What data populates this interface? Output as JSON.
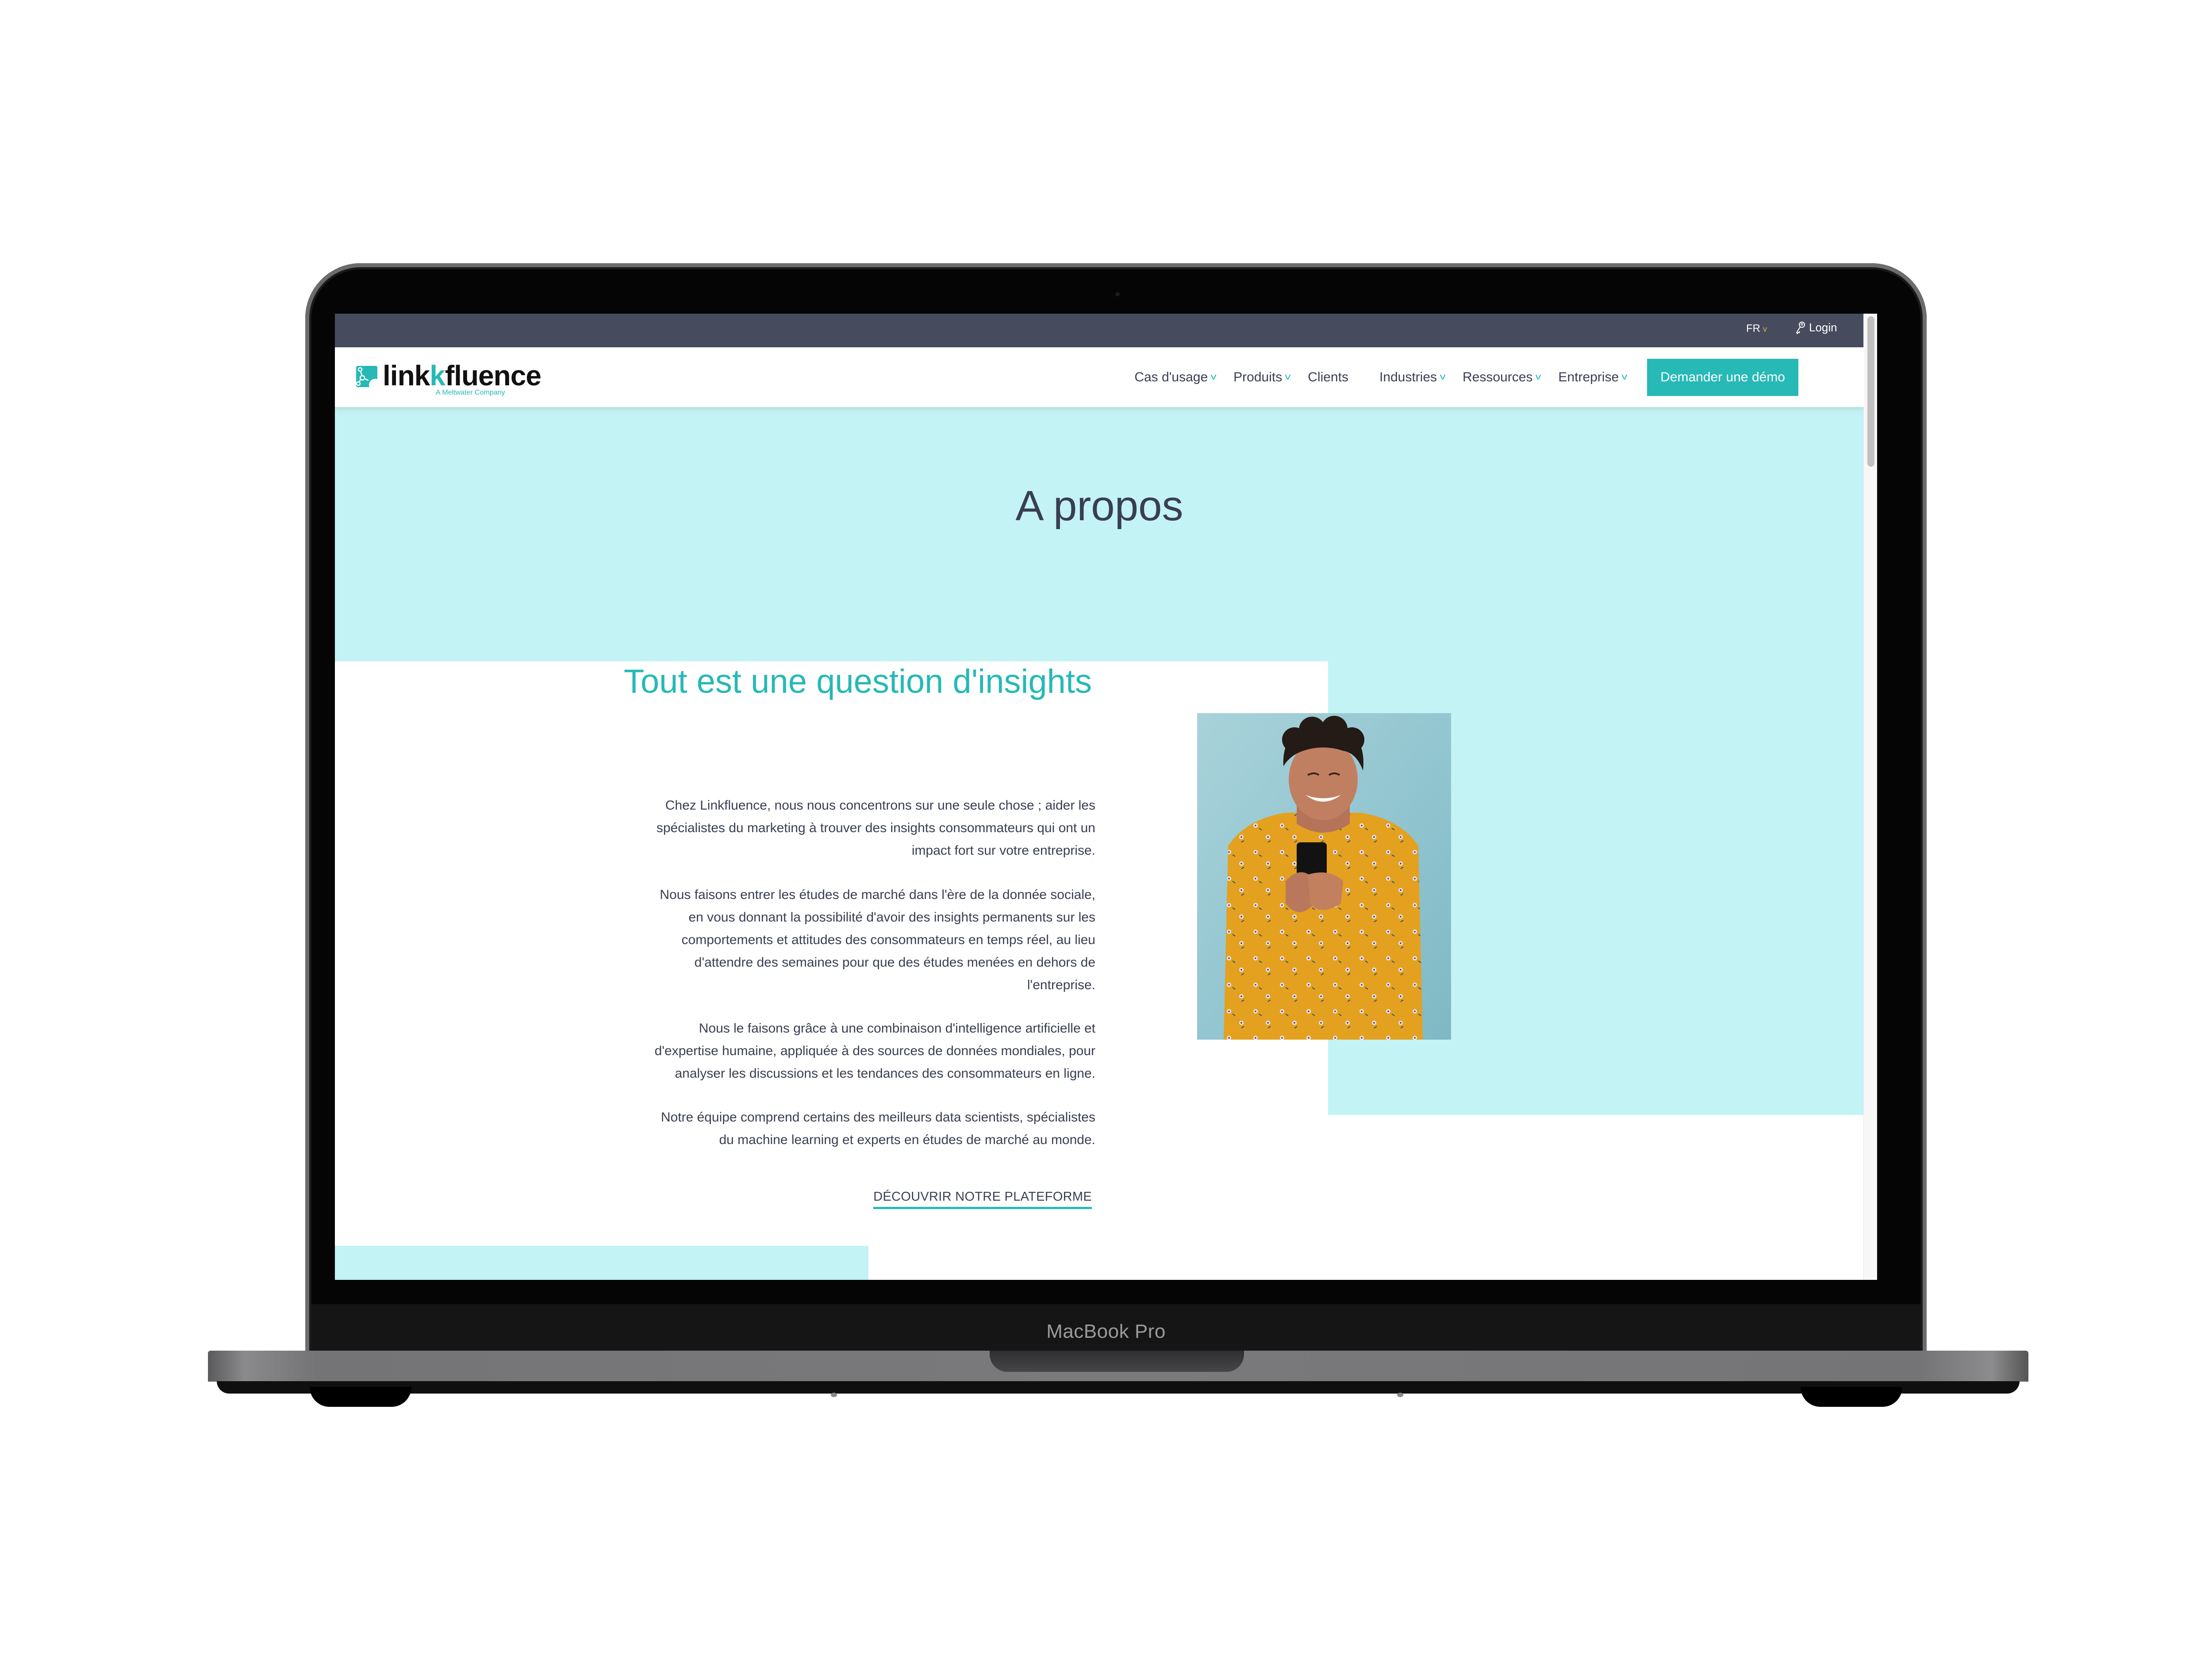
{
  "device": {
    "model_label": "MacBook Pro"
  },
  "topbar": {
    "language": "FR",
    "login_label": "Login",
    "login_icon": "key-icon"
  },
  "brand": {
    "logo_word_part1": "link",
    "logo_word_k": "k",
    "logo_word_part2": "fluence",
    "logo_tagline": "A Meltwater Company",
    "accent_color": "#26b9b6",
    "text_color": "#3a3e52",
    "topbar_color": "#474b5e",
    "hero_color": "#c3f3f4"
  },
  "nav": {
    "items": [
      {
        "label": "Cas d'usage",
        "has_dropdown": true
      },
      {
        "label": "Produits",
        "has_dropdown": true
      },
      {
        "label": "Clients",
        "has_dropdown": false
      },
      {
        "label": "Industries",
        "has_dropdown": true
      },
      {
        "label": "Ressources",
        "has_dropdown": true
      },
      {
        "label": "Entreprise",
        "has_dropdown": true
      }
    ],
    "cta_label": "Demander une démo",
    "chevron_glyph": "v"
  },
  "hero": {
    "title": "A propos"
  },
  "section": {
    "title": "Tout est une question d'insights",
    "paragraphs": [
      [
        "Chez Linkfluence, nous nous concentrons sur une seule chose ; aider les",
        "spécialistes du marketing à trouver des insights consommateurs qui ont un",
        "impact fort sur votre entreprise."
      ],
      [
        "Nous faisons entrer les études de marché dans l'ère de la donnée sociale,",
        "en vous donnant la possibilité d'avoir des insights permanents sur les",
        "comportements et attitudes des consommateurs en temps réel, au lieu",
        "d'attendre des semaines pour que des études menées en dehors de",
        "l'entreprise."
      ],
      [
        "Nous le faisons grâce à une combinaison d'intelligence artificielle et",
        "d'expertise humaine, appliquée à des sources de données mondiales, pour",
        "analyser les discussions et les tendances des consommateurs en ligne."
      ],
      [
        "Notre équipe comprend certains des meilleurs data scientists, spécialistes",
        "du machine learning et experts en études de marché au monde."
      ]
    ],
    "cta_label": "DÉCOUVRIR NOTRE PLATEFORME",
    "image_alt": "Woman in yellow floral blouse smiling at her smartphone against a light blue wall"
  }
}
